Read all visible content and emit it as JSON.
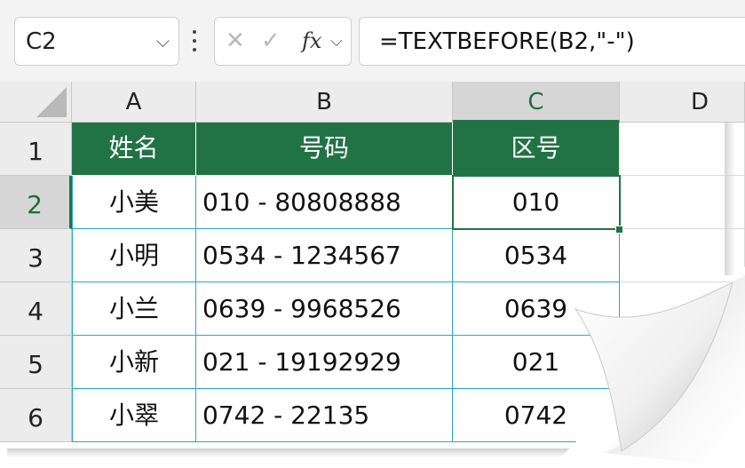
{
  "formula_bar": {
    "name_box": "C2",
    "cancel_icon": "✕",
    "enter_icon": "✓",
    "fx_label": "fx",
    "formula": "=TEXTBEFORE(B2,\"-\")"
  },
  "columns": [
    "A",
    "B",
    "C",
    "D"
  ],
  "rows": [
    "1",
    "2",
    "3",
    "4",
    "5",
    "6"
  ],
  "header": [
    "姓名",
    "号码",
    "区号"
  ],
  "data": [
    [
      "小美",
      "010 - 80808888",
      "010"
    ],
    [
      "小明",
      "0534 - 1234567",
      "0534"
    ],
    [
      "小兰",
      "0639 - 9968526",
      "0639"
    ],
    [
      "小新",
      "021 - 19192929",
      "021"
    ],
    [
      "小翠",
      "0742 - 22135",
      "0742"
    ]
  ],
  "selected_cell": "C2",
  "colors": {
    "accent": "#217346",
    "table_border": "#2ba7c6",
    "header_text": "#ffffff"
  }
}
